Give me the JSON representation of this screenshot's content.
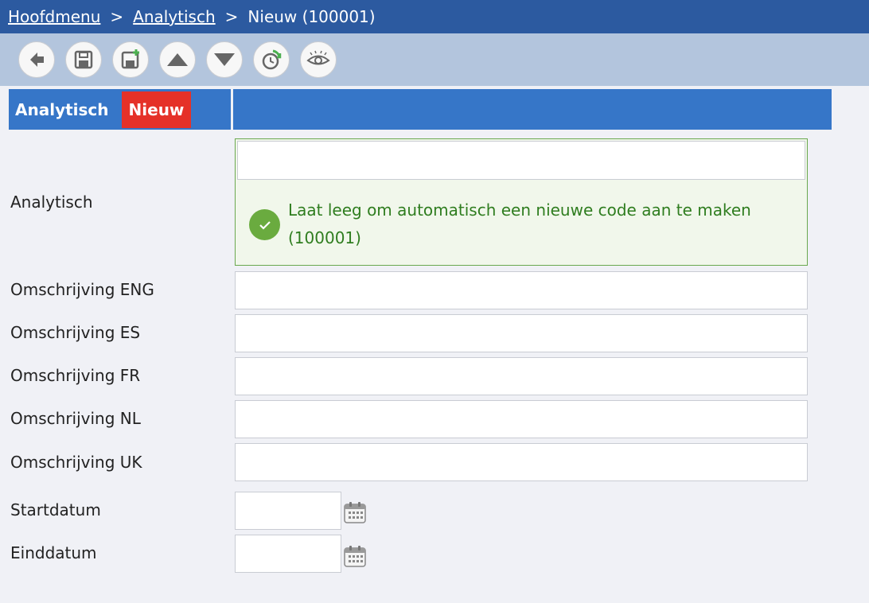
{
  "breadcrumb": {
    "home": "Hoofdmenu",
    "separator": ">",
    "section": "Analytisch",
    "current": "Nieuw (100001)"
  },
  "toolbar": {
    "buttons": [
      "back-icon",
      "save-icon",
      "save-new-icon",
      "triangle-up-icon",
      "triangle-down-icon",
      "history-icon",
      "eye-icon"
    ]
  },
  "section_header": {
    "title": "Analytisch",
    "badge": "Nieuw"
  },
  "form": {
    "analytisch": {
      "label": "Analytisch",
      "value": "",
      "hint": "Laat leeg om automatisch een nieuwe code aan te maken (100001)"
    },
    "omschrijving_eng": {
      "label": "Omschrijving ENG",
      "value": ""
    },
    "omschrijving_es": {
      "label": "Omschrijving ES",
      "value": ""
    },
    "omschrijving_fr": {
      "label": "Omschrijving FR",
      "value": ""
    },
    "omschrijving_nl": {
      "label": "Omschrijving NL",
      "value": ""
    },
    "omschrijving_uk": {
      "label": "Omschrijving UK",
      "value": ""
    },
    "startdatum": {
      "label": "Startdatum",
      "value": ""
    },
    "einddatum": {
      "label": "Einddatum",
      "value": ""
    }
  },
  "colors": {
    "breadcrumb_bg": "#2c5aa0",
    "toolbar_bg": "#b3c5dd",
    "header_bg": "#3676c8",
    "badge_bg": "#e53128",
    "hint_bg": "#f1f7eb",
    "hint_text": "#2f7d1f",
    "check_bg": "#6aab3f"
  }
}
